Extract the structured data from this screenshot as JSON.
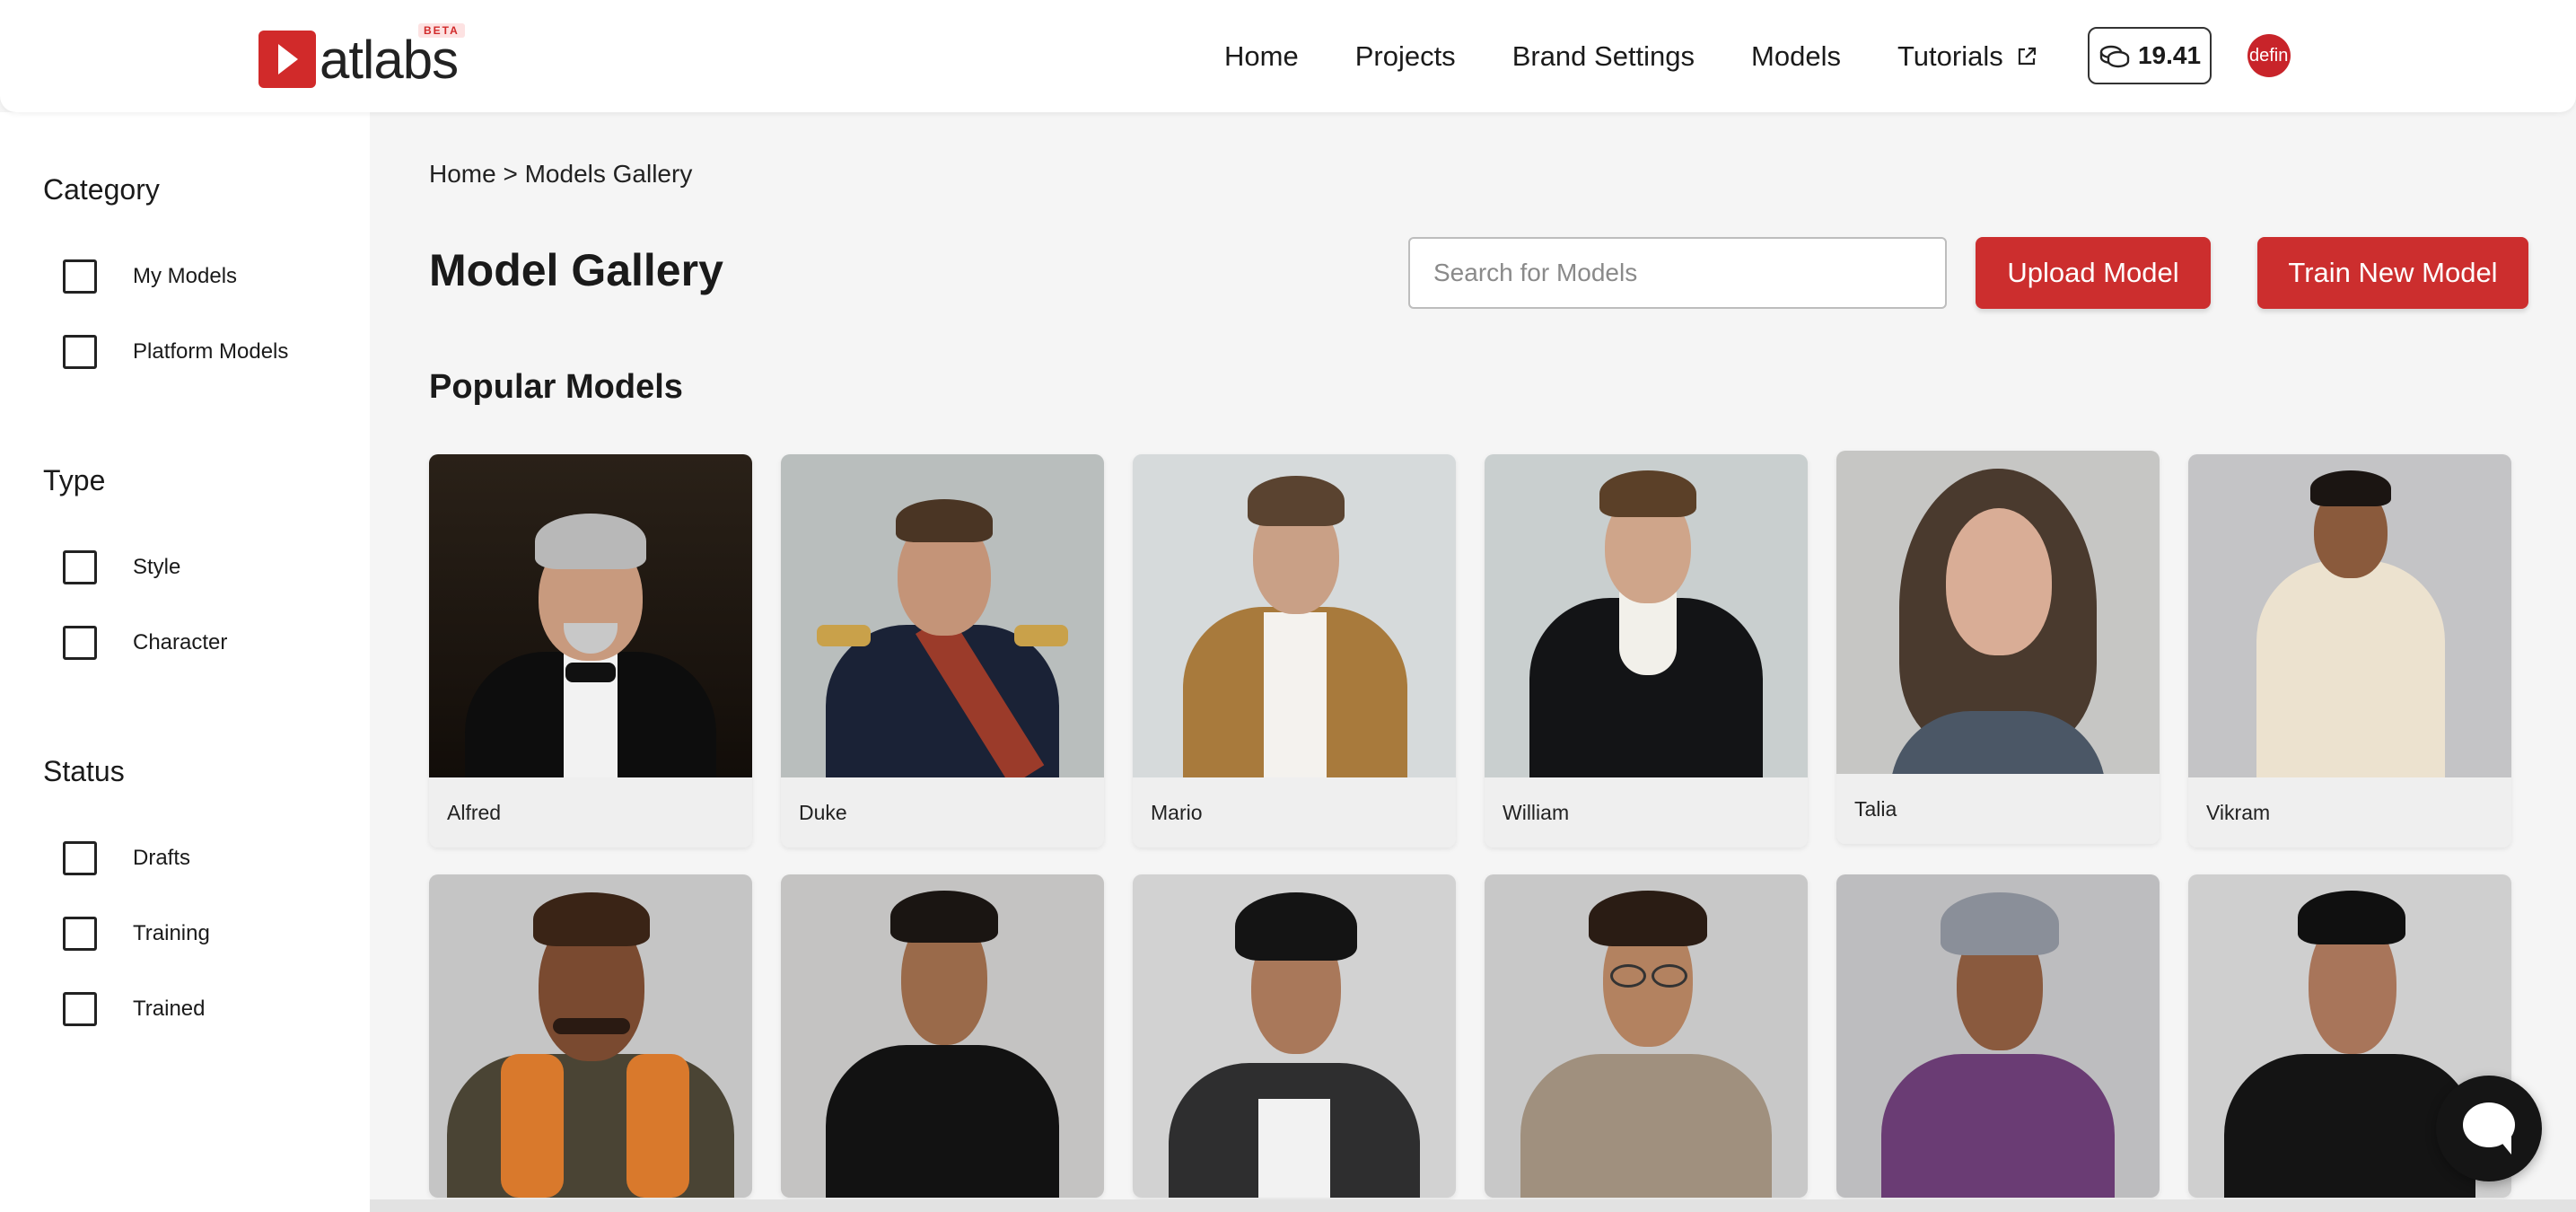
{
  "header": {
    "logo_first": "D",
    "logo_rest": "atlabs",
    "beta": "BETA",
    "nav": [
      "Home",
      "Projects",
      "Brand Settings",
      "Models",
      "Tutorials"
    ],
    "credits": "19.41",
    "avatar_text": "defin"
  },
  "sidebar": {
    "category": {
      "title": "Category",
      "items": [
        "My Models",
        "Platform Models"
      ]
    },
    "type": {
      "title": "Type",
      "items": [
        "Style",
        "Character"
      ]
    },
    "status": {
      "title": "Status",
      "items": [
        "Drafts",
        "Training",
        "Trained"
      ]
    }
  },
  "main": {
    "breadcrumb": "Home > Models Gallery",
    "title": "Model Gallery",
    "search_placeholder": "Search for Models",
    "upload_label": "Upload Model",
    "train_label": "Train New Model",
    "section_title": "Popular Models",
    "row1": [
      "Alfred",
      "Duke",
      "Mario",
      "William",
      "Talia",
      "Vikram"
    ]
  },
  "colors": {
    "accent": "#cc2e2e",
    "header_bg": "#ffffff",
    "page_bg": "#f5f5f5"
  },
  "icons": [
    "external-link-icon",
    "coins-icon",
    "chat-icon"
  ]
}
